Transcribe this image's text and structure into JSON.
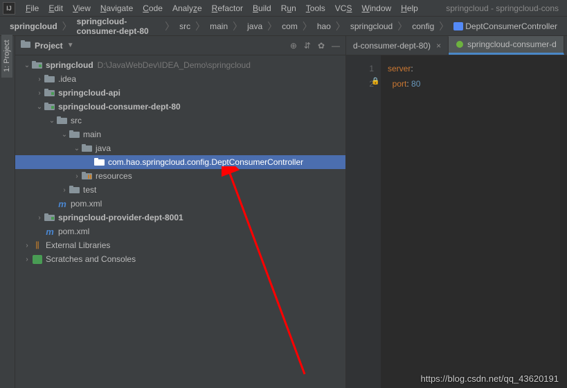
{
  "menubar": {
    "items": [
      {
        "html": "<u>F</u>ile"
      },
      {
        "html": "<u>E</u>dit"
      },
      {
        "html": "<u>V</u>iew"
      },
      {
        "html": "<u>N</u>avigate"
      },
      {
        "html": "<u>C</u>ode"
      },
      {
        "html": "Analy<u>z</u>e"
      },
      {
        "html": "<u>R</u>efactor"
      },
      {
        "html": "<u>B</u>uild"
      },
      {
        "html": "R<u>u</u>n"
      },
      {
        "html": "<u>T</u>ools"
      },
      {
        "html": "VC<u>S</u>"
      },
      {
        "html": "<u>W</u>indow"
      },
      {
        "html": "<u>H</u>elp"
      }
    ],
    "title": "springcloud - springcloud-cons"
  },
  "breadcrumb": [
    {
      "label": "springcloud",
      "bold": true
    },
    {
      "label": "springcloud-consumer-dept-80",
      "bold": true
    },
    {
      "label": "src"
    },
    {
      "label": "main"
    },
    {
      "label": "java"
    },
    {
      "label": "com"
    },
    {
      "label": "hao"
    },
    {
      "label": "springcloud"
    },
    {
      "label": "config"
    },
    {
      "label": "DeptConsumerController",
      "icon": "class"
    }
  ],
  "sidebar": {
    "tab_label": "1: Project"
  },
  "project_panel": {
    "title": "Project"
  },
  "tree": [
    {
      "depth": 0,
      "arrow": "open",
      "icon": "module",
      "label": "springcloud",
      "bold": true,
      "extra": "D:\\JavaWebDev\\IDEA_Demo\\springcloud"
    },
    {
      "depth": 1,
      "arrow": "closed",
      "icon": "folder",
      "label": ".idea"
    },
    {
      "depth": 1,
      "arrow": "closed",
      "icon": "module",
      "label": "springcloud-api",
      "bold": true
    },
    {
      "depth": 1,
      "arrow": "open",
      "icon": "module",
      "label": "springcloud-consumer-dept-80",
      "bold": true
    },
    {
      "depth": 2,
      "arrow": "open",
      "icon": "folder",
      "label": "src"
    },
    {
      "depth": 3,
      "arrow": "open",
      "icon": "folder",
      "label": "main"
    },
    {
      "depth": 4,
      "arrow": "open",
      "icon": "folder",
      "label": "java"
    },
    {
      "depth": 5,
      "arrow": "none",
      "icon": "class",
      "label": "com.hao.springcloud.config.DeptConsumerController",
      "selected": true
    },
    {
      "depth": 4,
      "arrow": "closed",
      "icon": "resources",
      "label": "resources"
    },
    {
      "depth": 3,
      "arrow": "closed",
      "icon": "folder",
      "label": "test"
    },
    {
      "depth": 2,
      "arrow": "none",
      "icon": "maven",
      "label": "pom.xml"
    },
    {
      "depth": 1,
      "arrow": "closed",
      "icon": "module",
      "label": "springcloud-provider-dept-8001",
      "bold": true
    },
    {
      "depth": 1,
      "arrow": "none",
      "icon": "maven",
      "label": "pom.xml"
    },
    {
      "depth": 0,
      "arrow": "closed",
      "icon": "libs",
      "label": "External Libraries"
    },
    {
      "depth": 0,
      "arrow": "closed",
      "icon": "scratch",
      "label": "Scratches and Consoles"
    }
  ],
  "editor": {
    "tabs": [
      {
        "label": "d-consumer-dept-80)",
        "active": false,
        "hasClose": true
      },
      {
        "label": "springcloud-consumer-d",
        "active": true,
        "hasClose": false,
        "icon": "spring"
      }
    ],
    "lines": [
      "1",
      "2"
    ],
    "code": {
      "line1_key": "server",
      "line1_colon": ":",
      "line2_key": "port",
      "line2_colon": ":",
      "line2_val": "80"
    }
  },
  "footer": "https://blog.csdn.net/qq_43620191"
}
